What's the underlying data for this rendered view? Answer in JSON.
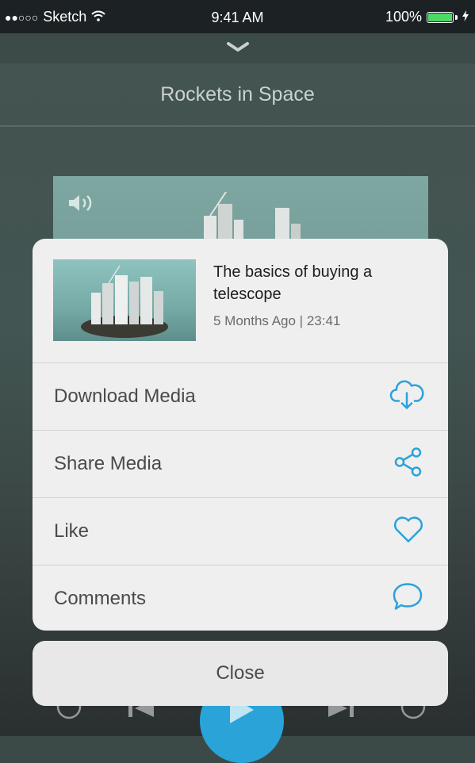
{
  "status_bar": {
    "signal": "●●○○○",
    "carrier": "Sketch",
    "time": "9:41 AM",
    "battery_percent": "100%",
    "battery_level": 1.0
  },
  "now_playing": {
    "title": "Rockets in Space"
  },
  "action_sheet": {
    "media": {
      "title": "The basics of buying a telescope",
      "meta": "5 Months Ago | 23:41"
    },
    "actions": [
      {
        "label": "Download Media",
        "icon": "cloud-download-icon"
      },
      {
        "label": "Share Media",
        "icon": "share-icon"
      },
      {
        "label": "Like",
        "icon": "heart-icon"
      },
      {
        "label": "Comments",
        "icon": "comment-icon"
      }
    ],
    "close_label": "Close"
  },
  "colors": {
    "accent": "#2aa3d9",
    "sheet_bg": "#efefef",
    "status_bar_bg": "#1c2123"
  }
}
